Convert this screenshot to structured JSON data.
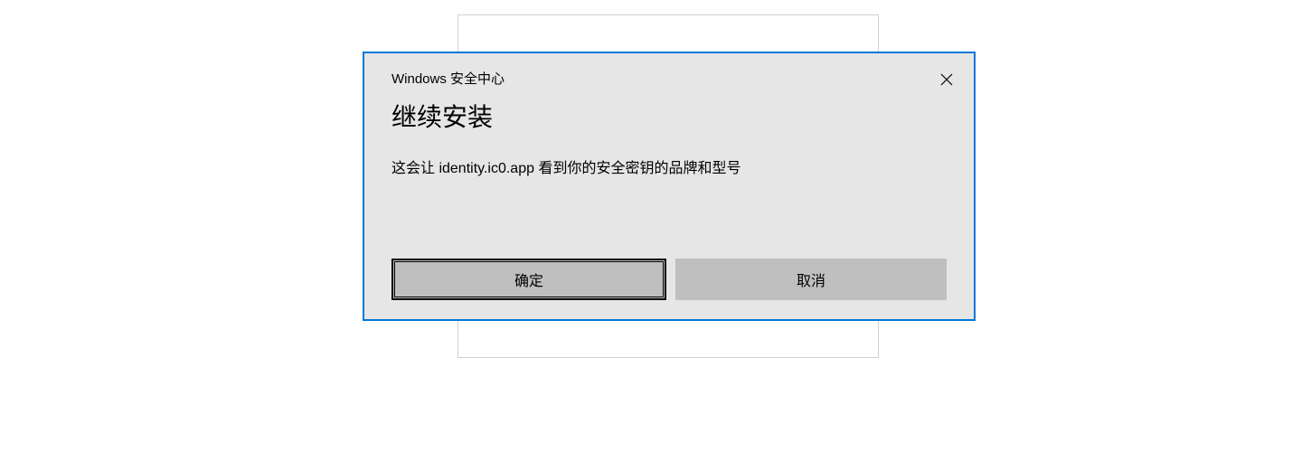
{
  "dialog": {
    "title_small": "Windows 安全中心",
    "headline": "继续安装",
    "body_text": "这会让 identity.ic0.app 看到你的安全密钥的品牌和型号",
    "ok_label": "确定",
    "cancel_label": "取消"
  }
}
